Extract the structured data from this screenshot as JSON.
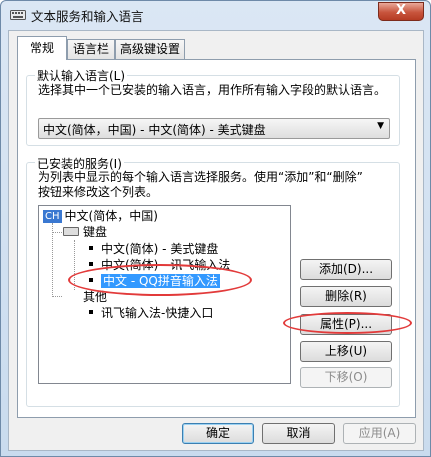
{
  "window": {
    "title": "文本服务和输入语言",
    "close_label": "X"
  },
  "tabs": [
    {
      "label": "常规",
      "active": true
    },
    {
      "label": "语言栏",
      "active": false
    },
    {
      "label": "高级键设置",
      "active": false
    }
  ],
  "default_language": {
    "group_label": "默认输入语言(L)",
    "description": "选择其中一个已安装的输入语言，用作所有输入字段的默认语言。",
    "selected": "中文(简体，中国) - 中文(简体) - 美式键盘"
  },
  "installed_services": {
    "group_label": "已安装的服务(I)",
    "description_line1": "为列表中显示的每个输入语言选择服务。使用“添加”和“删除”",
    "description_line2": "按钮来修改这个列表。",
    "tree": {
      "language_badge": "CH",
      "language": "中文(简体，中国)",
      "keyboard_group": "键盘",
      "keyboards": [
        "中文(简体) - 美式键盘",
        "中文(简体) - 讯飞输入法",
        "中文 - QQ拼音输入法"
      ],
      "other_group": "其他",
      "others": [
        "讯飞输入法-快捷入口"
      ]
    }
  },
  "side_buttons": {
    "add": "添加(D)...",
    "remove": "删除(R)",
    "properties": "属性(P)...",
    "move_up": "上移(U)",
    "move_down": "下移(O)"
  },
  "footer_buttons": {
    "ok": "确定",
    "cancel": "取消",
    "apply": "应用(A)"
  },
  "colors": {
    "selection": "#3399ff",
    "annotation": "#e23a3a",
    "close": "#c8553d"
  }
}
